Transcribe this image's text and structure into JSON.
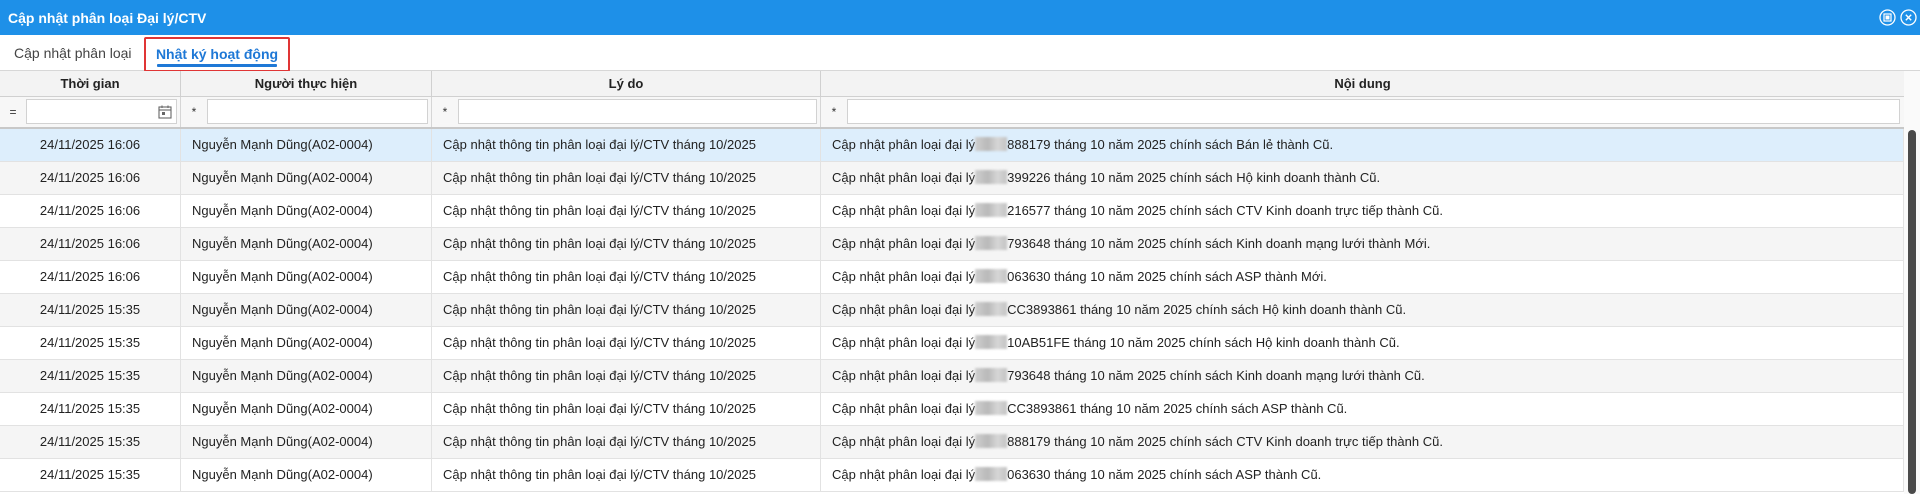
{
  "window": {
    "title": "Cập nhật phân loại Đại lý/CTV"
  },
  "tabs": [
    {
      "label": "Cập nhật phân loại"
    },
    {
      "label": "Nhật ký hoạt động"
    }
  ],
  "columns": {
    "time": "Thời gian",
    "user": "Người thực hiện",
    "reason": "Lý do",
    "content": "Nội dung"
  },
  "filters": {
    "time_op": "=",
    "user_op": "*",
    "reason_op": "*",
    "content_op": "*"
  },
  "rows": [
    {
      "time": "24/11/2025 16:06",
      "user": "Nguyễn Mạnh Dũng(A02-0004)",
      "reason": "Cập nhật thông tin phân loại đại lý/CTV tháng 10/2025",
      "content_prefix": "Cập nhật phân loại đại lý",
      "content_suffix": "888179 tháng 10 năm 2025 chính sách Bán lẻ thành Cũ."
    },
    {
      "time": "24/11/2025 16:06",
      "user": "Nguyễn Mạnh Dũng(A02-0004)",
      "reason": "Cập nhật thông tin phân loại đại lý/CTV tháng 10/2025",
      "content_prefix": "Cập nhật phân loại đại lý",
      "content_suffix": "399226 tháng 10 năm 2025 chính sách Hộ kinh doanh thành Cũ."
    },
    {
      "time": "24/11/2025 16:06",
      "user": "Nguyễn Mạnh Dũng(A02-0004)",
      "reason": "Cập nhật thông tin phân loại đại lý/CTV tháng 10/2025",
      "content_prefix": "Cập nhật phân loại đại lý",
      "content_suffix": "216577 tháng 10 năm 2025 chính sách CTV Kinh doanh trực tiếp thành Cũ."
    },
    {
      "time": "24/11/2025 16:06",
      "user": "Nguyễn Mạnh Dũng(A02-0004)",
      "reason": "Cập nhật thông tin phân loại đại lý/CTV tháng 10/2025",
      "content_prefix": "Cập nhật phân loại đại lý",
      "content_suffix": "793648 tháng 10 năm 2025 chính sách Kinh doanh mạng lưới thành Mới."
    },
    {
      "time": "24/11/2025 16:06",
      "user": "Nguyễn Mạnh Dũng(A02-0004)",
      "reason": "Cập nhật thông tin phân loại đại lý/CTV tháng 10/2025",
      "content_prefix": "Cập nhật phân loại đại lý",
      "content_suffix": "063630 tháng 10 năm 2025 chính sách ASP thành Mới."
    },
    {
      "time": "24/11/2025 15:35",
      "user": "Nguyễn Mạnh Dũng(A02-0004)",
      "reason": "Cập nhật thông tin phân loại đại lý/CTV tháng 10/2025",
      "content_prefix": "Cập nhật phân loại đại lý",
      "content_suffix": "CC3893861 tháng 10 năm 2025 chính sách Hộ kinh doanh thành Cũ."
    },
    {
      "time": "24/11/2025 15:35",
      "user": "Nguyễn Mạnh Dũng(A02-0004)",
      "reason": "Cập nhật thông tin phân loại đại lý/CTV tháng 10/2025",
      "content_prefix": "Cập nhật phân loại đại lý",
      "content_suffix": "10AB51FE tháng 10 năm 2025 chính sách Hộ kinh doanh thành Cũ."
    },
    {
      "time": "24/11/2025 15:35",
      "user": "Nguyễn Mạnh Dũng(A02-0004)",
      "reason": "Cập nhật thông tin phân loại đại lý/CTV tháng 10/2025",
      "content_prefix": "Cập nhật phân loại đại lý",
      "content_suffix": "793648 tháng 10 năm 2025 chính sách Kinh doanh mạng lưới thành Cũ."
    },
    {
      "time": "24/11/2025 15:35",
      "user": "Nguyễn Mạnh Dũng(A02-0004)",
      "reason": "Cập nhật thông tin phân loại đại lý/CTV tháng 10/2025",
      "content_prefix": "Cập nhật phân loại đại lý",
      "content_suffix": "CC3893861 tháng 10 năm 2025 chính sách ASP thành Cũ."
    },
    {
      "time": "24/11/2025 15:35",
      "user": "Nguyễn Mạnh Dũng(A02-0004)",
      "reason": "Cập nhật thông tin phân loại đại lý/CTV tháng 10/2025",
      "content_prefix": "Cập nhật phân loại đại lý",
      "content_suffix": "888179 tháng 10 năm 2025 chính sách CTV Kinh doanh trực tiếp thành Cũ."
    },
    {
      "time": "24/11/2025 15:35",
      "user": "Nguyễn Mạnh Dũng(A02-0004)",
      "reason": "Cập nhật thông tin phân loại đại lý/CTV tháng 10/2025",
      "content_prefix": "Cập nhật phân loại đại lý",
      "content_suffix": "063630 tháng 10 năm 2025 chính sách ASP thành Cũ."
    }
  ],
  "icons": {
    "maximize": "restore-window-icon",
    "close": "close-icon",
    "calendar": "calendar-icon"
  },
  "colors": {
    "titlebar": "#1e90e8",
    "active_tab": "#1e78d6",
    "highlight_border": "#e03535",
    "selected_row": "#ddeefc"
  }
}
